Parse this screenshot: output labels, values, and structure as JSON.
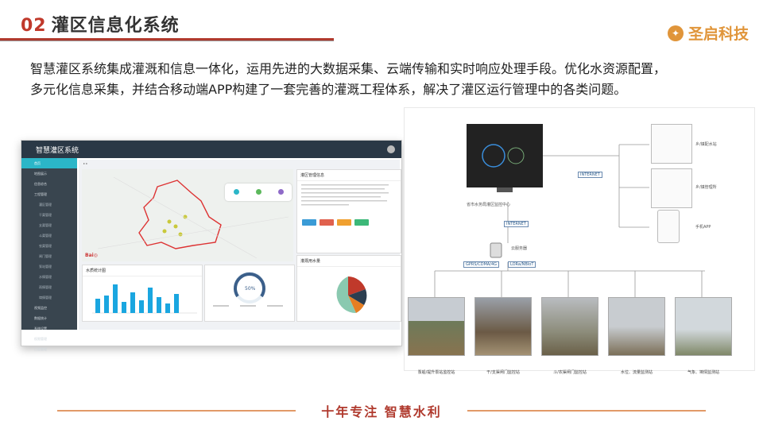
{
  "header": {
    "number": "02",
    "title": "灌区信息化系统"
  },
  "brand": {
    "name": "圣启科技",
    "color": "#e0953a"
  },
  "intro": {
    "line1": "智慧灌区系统集成灌溉和信息一体化，运用先进的大数据采集、云端传输和实时响应处理手段。优化水资源配置，",
    "line2": "多元化信息采集，并结合移动端APP构建了一套完善的灌溉工程体系，解决了灌区运行管理中的各类问题。"
  },
  "dashboard": {
    "title": "智慧灌区系统",
    "sidebar": [
      "首页",
      "地图展示",
      "信息综合",
      "工程管理",
      "灌区管理",
      "干渠管理",
      "支渠管理",
      "斗渠管理",
      "农渠管理",
      "闸门管理",
      "泵站管理",
      "水情管理",
      "雨情管理",
      "墒情管理",
      "视频监控",
      "数据统计",
      "系统设置",
      "权限管理",
      "日志管理"
    ],
    "info_title": "灌区管理信息",
    "bars_title": "水质统计图",
    "gauge_value": "50%",
    "pie_title": "灌溉用水量"
  },
  "architecture": {
    "center_label": "省市水务局灌区监控中心",
    "net1": "INTERNET",
    "net2": "INTERNET",
    "server": "云服务器",
    "net_left": "GPRS/CDMA/4G",
    "net_right": "LORa/NBIoT",
    "terminals": [
      {
        "label": "乡/镇配水站"
      },
      {
        "label": "乡/镇管理所"
      },
      {
        "label": "手机APP"
      }
    ],
    "stations": [
      {
        "label": "泵船/提升泵站监控站"
      },
      {
        "label": "干/支渠闸门监控站"
      },
      {
        "label": "斗/农渠闸门监控站"
      },
      {
        "label": "水位、流量监测站"
      },
      {
        "label": "气象、墒情监测站"
      }
    ]
  },
  "slogan": "十年专注 智慧水利"
}
